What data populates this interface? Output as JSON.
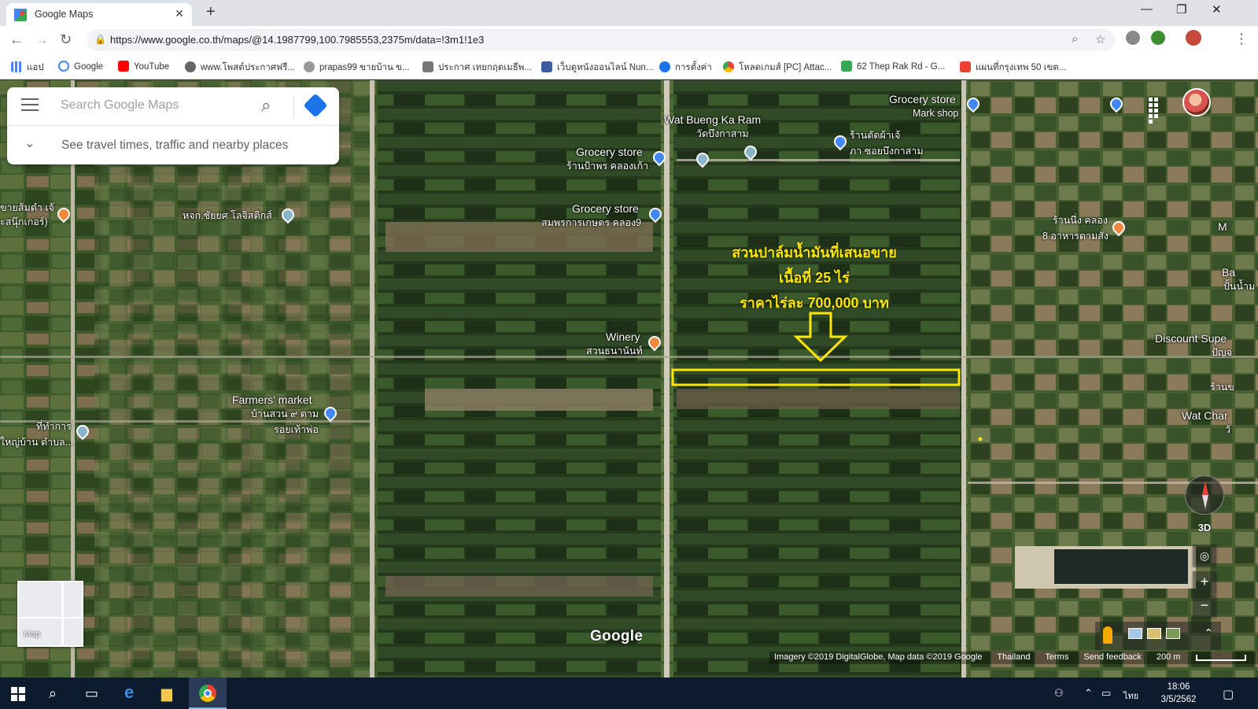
{
  "browser": {
    "tab_title": "Google Maps",
    "url": "https://www.google.co.th/maps/@14.1987799,100.7985553,2375m/data=!3m1!1e3",
    "bookmarks": [
      {
        "label": "แอป",
        "icon": "apps-grid-icon"
      },
      {
        "label": "Google",
        "icon": "google-icon"
      },
      {
        "label": "YouTube",
        "icon": "youtube-icon"
      },
      {
        "label": "www.โพสต์ประกาศฟรี...",
        "icon": "globe-icon"
      },
      {
        "label": "prapas99 ขายบ้าน ข...",
        "icon": "site-icon"
      },
      {
        "label": "ประกาศ เทยกฤตเมธีพ...",
        "icon": "site-icon"
      },
      {
        "label": "เว็บดูหนังออนไลน์ Nun...",
        "icon": "site-icon"
      },
      {
        "label": "การตั้งค่า",
        "icon": "gear-icon"
      },
      {
        "label": "โหลดเกมส์ [PC] Attac...",
        "icon": "site-icon"
      },
      {
        "label": "62 Thep Rak Rd - G...",
        "icon": "maps-icon"
      },
      {
        "label": "แผนที่กรุงเทพ 50 เขต...",
        "icon": "maps-pin-icon"
      }
    ]
  },
  "maps": {
    "search_placeholder": "Search Google Maps",
    "sub_text": "See travel times, traffic and nearby places",
    "layer_label": "Map",
    "logo": "Google",
    "btn_3d": "3D",
    "zoom_in": "+",
    "zoom_out": "−",
    "attribution": {
      "imagery": "Imagery ©2019 DigitalGlobe, Map data ©2019 Google",
      "country": "Thailand",
      "terms": "Terms",
      "feedback": "Send feedback",
      "scale": "200 m"
    },
    "annotation": {
      "line1": "สวนปาล์มน้ำมันที่เสนอขาย",
      "line2": "เนื้อที่  25 ไร่",
      "line3": "ราคาไร่ละ 700,000 บาท"
    },
    "places": {
      "wat_bueng_en": "Wat Bueng Ka Ram",
      "wat_bueng_th": "วัดบึงกาสาม",
      "grocery1_en": "Grocery store",
      "grocery1_th": "ร้านป้าพร คลองเก้า",
      "grocery2_en": "Grocery store",
      "grocery2_th": "สมพรการเกษตร คลอง9",
      "grocery3_en": "Grocery store",
      "grocery3_th": "Mark shop",
      "haircut_th1": "ร้านตัดผ้าเจ้",
      "haircut_th2": "ภา ซอยบึงกาสาม",
      "winery_en": "Winery",
      "winery_th": "สวนธนานันท์",
      "farmers_en": "Farmers' market",
      "farmers_th1": "บ้านสวน ๙ ตาม",
      "farmers_th2": "รอยเท้าพ่อ",
      "logistics_th": "หจก.ชัยยศ โลจิสติกส์",
      "somtam_th1": "ขายส้มตำ เจ้",
      "somtam_th2": "ะสนุ๊กเกอร์)",
      "office_th1": "ที่ทำการ",
      "office_th2": "ใหญ่บ้าน ตำบล...",
      "raan_nueng_th1": "ร้านนึ่ง คลอง",
      "raan_nueng_th2": "8 อาหารตามสั่ง",
      "discount_en": "Discount Supe",
      "discount_th": "ปัญจ",
      "wat_char_en": "Wat Char",
      "wat_char_th": "วั",
      "edge_ba": "Ba",
      "edge_ban_th": "ปั้นน้ำม",
      "edge_m": "M",
      "edge_raan_kh": "ร้านข"
    }
  },
  "taskbar": {
    "time": "18:06",
    "date": "3/5/2562",
    "lang": "ไทย"
  }
}
